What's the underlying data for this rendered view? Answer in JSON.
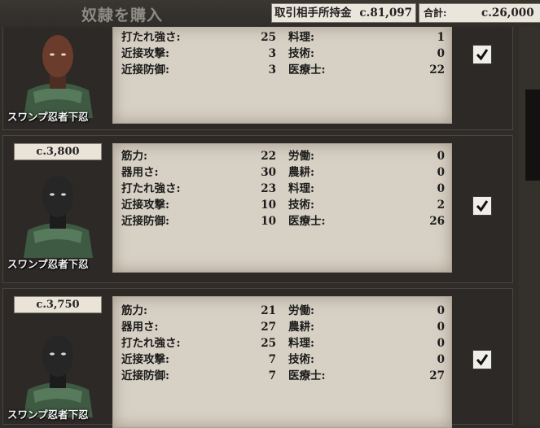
{
  "header": {
    "title": "奴隷を購入",
    "trader_funds_label": "取引相手所持金",
    "trader_funds_value": "c.81,097",
    "total_label": "合計:",
    "total_value": "c.26,000"
  },
  "slaves": [
    {
      "price": "",
      "name": "スワンプ忍者下忍",
      "selected": true,
      "stats_left": [
        {
          "label": "打たれ強さ:",
          "value": "25"
        },
        {
          "label": "近接攻撃:",
          "value": "3"
        },
        {
          "label": "近接防御:",
          "value": "3"
        }
      ],
      "stats_right": [
        {
          "label": "料理:",
          "value": "1"
        },
        {
          "label": "技術:",
          "value": "0"
        },
        {
          "label": "医療士:",
          "value": "22"
        }
      ]
    },
    {
      "price": "c.3,800",
      "name": "スワンプ忍者下忍",
      "selected": true,
      "stats_left": [
        {
          "label": "筋力:",
          "value": "22"
        },
        {
          "label": "器用さ:",
          "value": "30"
        },
        {
          "label": "打たれ強さ:",
          "value": "23"
        },
        {
          "label": "近接攻撃:",
          "value": "10"
        },
        {
          "label": "近接防御:",
          "value": "10"
        }
      ],
      "stats_right": [
        {
          "label": "労働:",
          "value": "0"
        },
        {
          "label": "農耕:",
          "value": "0"
        },
        {
          "label": "料理:",
          "value": "0"
        },
        {
          "label": "技術:",
          "value": "2"
        },
        {
          "label": "医療士:",
          "value": "26"
        }
      ]
    },
    {
      "price": "c.3,750",
      "name": "スワンプ忍者下忍",
      "selected": true,
      "stats_left": [
        {
          "label": "筋力:",
          "value": "21"
        },
        {
          "label": "器用さ:",
          "value": "27"
        },
        {
          "label": "打たれ強さ:",
          "value": "25"
        },
        {
          "label": "近接攻撃:",
          "value": "7"
        },
        {
          "label": "近接防御:",
          "value": "7"
        }
      ],
      "stats_right": [
        {
          "label": "労働:",
          "value": "0"
        },
        {
          "label": "農耕:",
          "value": "0"
        },
        {
          "label": "料理:",
          "value": "0"
        },
        {
          "label": "技術:",
          "value": "0"
        },
        {
          "label": "医療士:",
          "value": "27"
        }
      ]
    }
  ],
  "icons": {
    "checkbox": "checkmark-icon",
    "portrait": "character-portrait"
  },
  "colors": {
    "panel": "#d7d0c4",
    "background": "#2f2c29",
    "text": "#1b1b1b"
  }
}
